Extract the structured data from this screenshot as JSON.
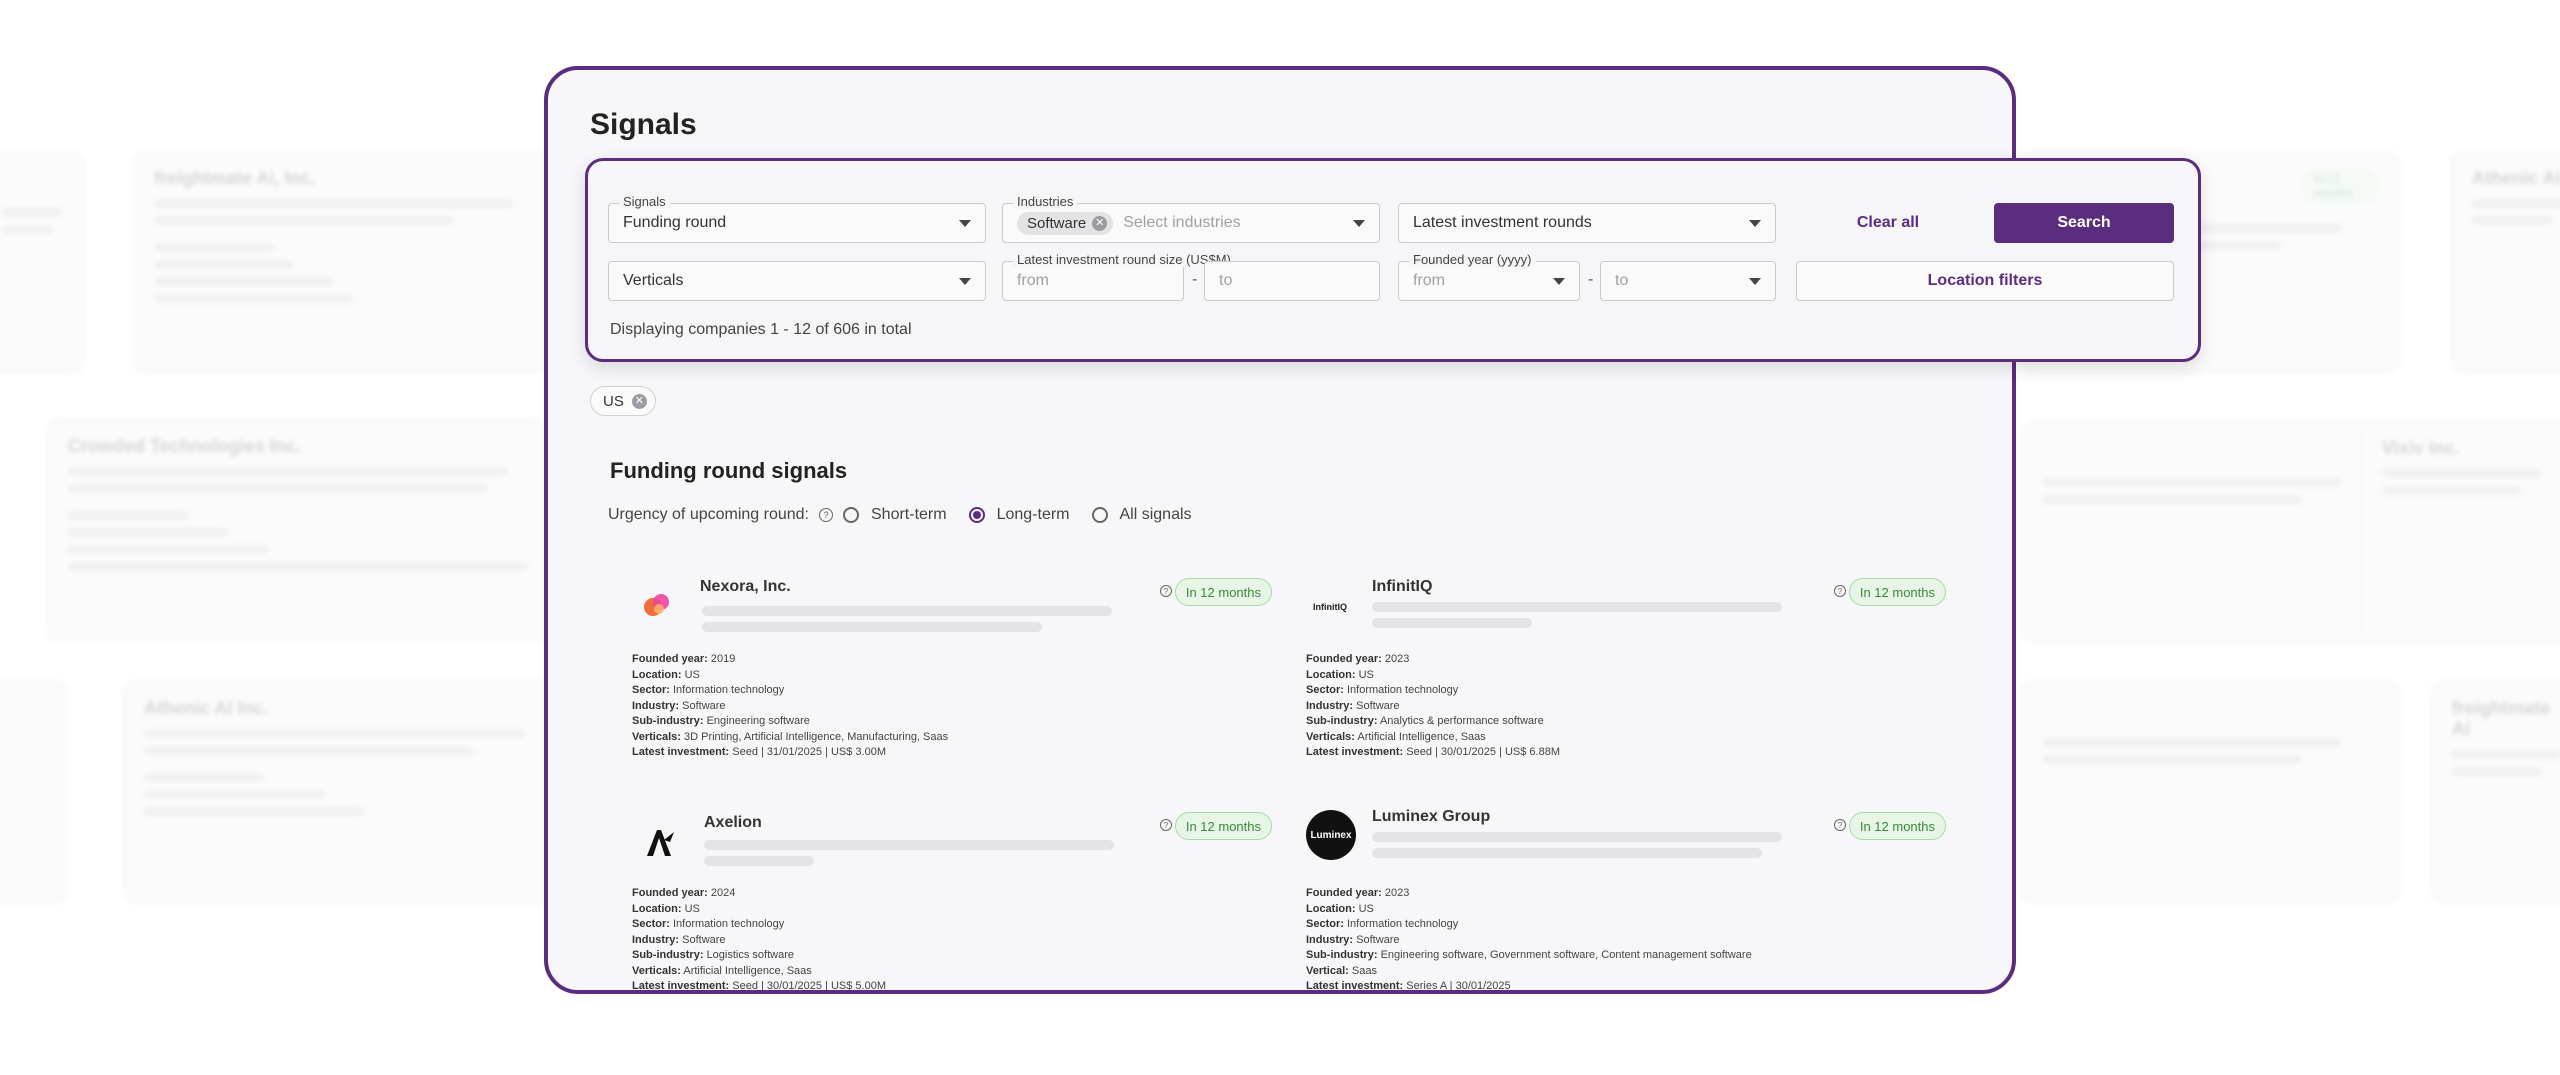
{
  "page": {
    "title": "Signals"
  },
  "filters": {
    "signals": {
      "label": "Signals",
      "value": "Funding round"
    },
    "industries": {
      "label": "Industries",
      "chip": "Software",
      "placeholder": "Select industries"
    },
    "latest_rounds": {
      "value": "Latest investment rounds"
    },
    "verticals": {
      "value": "Verticals"
    },
    "round_size": {
      "label": "Latest investment round size (US$M)",
      "from_placeholder": "from",
      "to_placeholder": "to"
    },
    "founded_year": {
      "label": "Founded year (yyyy)",
      "from": "from",
      "to": "to"
    },
    "clear_all": "Clear all",
    "search": "Search",
    "location_filters": "Location filters",
    "displaying": "Displaying companies 1 - 12 of 606 in total",
    "location_chip": "US"
  },
  "section": {
    "title": "Funding round signals",
    "urgency_label": "Urgency of upcoming round:",
    "options": [
      "Short-term",
      "Long-term",
      "All signals"
    ],
    "selected": "Long-term"
  },
  "labels": {
    "founded_year": "Founded year:",
    "location": "Location:",
    "sector": "Sector:",
    "industry": "Industry:",
    "sub_industry": "Sub-industry:",
    "verticals": "Verticals:",
    "vertical": "Vertical:",
    "latest_investment": "Latest investment:"
  },
  "companies": [
    {
      "name": "Nexora, Inc.",
      "badge": "In 12 months",
      "founded_year": "2019",
      "location": "US",
      "sector": "Information technology",
      "industry": "Software",
      "sub_industry": "Engineering software",
      "verticals": "3D Printing, Artificial Intelligence, Manufacturing, Saas",
      "latest_investment": "Seed | 31/01/2025 | US$ 3.00M"
    },
    {
      "name": "InfinitIQ",
      "logo_text": "InfinitIQ",
      "badge": "In 12 months",
      "founded_year": "2023",
      "location": "US",
      "sector": "Information technology",
      "industry": "Software",
      "sub_industry": "Analytics & performance software",
      "verticals": "Artificial Intelligence, Saas",
      "latest_investment": "Seed | 30/01/2025 | US$ 6.88M"
    },
    {
      "name": "Axelion",
      "badge": "In 12 months",
      "founded_year": "2024",
      "location": "US",
      "sector": "Information technology",
      "industry": "Software",
      "sub_industry": "Logistics software",
      "verticals": "Artificial Intelligence, Saas",
      "latest_investment": "Seed | 30/01/2025 | US$ 5.00M"
    },
    {
      "name": "Luminex Group",
      "logo_text": "Luminex",
      "badge": "In 12 months",
      "founded_year": "2023",
      "location": "US",
      "sector": "Information technology",
      "industry": "Software",
      "sub_industry": "Engineering software, Government software, Content management software",
      "vertical": "Saas",
      "latest_investment": "Series A | 30/01/2025"
    }
  ],
  "background_cards": [
    {
      "title": "freightmate Ai, Inc."
    },
    {
      "title": "Crowded Technologies Inc."
    },
    {
      "title": "Athenic AI Inc."
    },
    {
      "title": "Athenic AI"
    },
    {
      "title": "Vixiv Inc."
    },
    {
      "title": "freightmate Ai"
    }
  ],
  "colors": {
    "accent": "#5b2d7e",
    "badge_bg": "#e6f5e6",
    "badge_text": "#3a8a3a"
  }
}
